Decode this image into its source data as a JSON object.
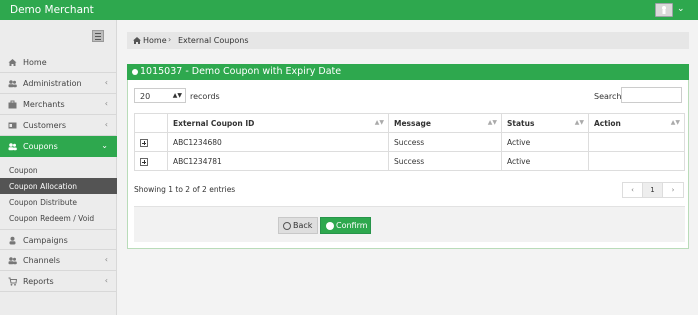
{
  "app": {
    "title": "Demo Merchant"
  },
  "sidebar": {
    "items": [
      {
        "label": "Home",
        "icon": "home-icon",
        "chevron": ""
      },
      {
        "label": "Administration",
        "icon": "users-icon",
        "chevron": "‹"
      },
      {
        "label": "Merchants",
        "icon": "briefcase-icon",
        "chevron": "‹"
      },
      {
        "label": "Customers",
        "icon": "id-card-icon",
        "chevron": "‹"
      },
      {
        "label": "Coupons",
        "icon": "users-icon",
        "chevron": "⌄"
      },
      {
        "label": "Campaigns",
        "icon": "user-icon",
        "chevron": ""
      },
      {
        "label": "Channels",
        "icon": "users-icon",
        "chevron": "‹"
      },
      {
        "label": "Reports",
        "icon": "cart-icon",
        "chevron": "‹"
      }
    ],
    "sub_items": [
      {
        "label": "Coupon"
      },
      {
        "label": "Coupon Allocation"
      },
      {
        "label": "Coupon Distribute"
      },
      {
        "label": "Coupon Redeem / Void"
      }
    ]
  },
  "breadcrumb": {
    "home": "Home",
    "separator": "›",
    "current": "External Coupons"
  },
  "panel": {
    "title": "1015037 - Demo Coupon with Expiry Date",
    "length_value": "20",
    "records_label": "records",
    "search_label": "Search:",
    "search_value": "",
    "columns": [
      "",
      "External Coupon ID",
      "Message",
      "Status",
      "Action"
    ],
    "rows": [
      {
        "id": "ABC1234680",
        "message": "Success",
        "status": "Active",
        "action": ""
      },
      {
        "id": "ABC1234781",
        "message": "Success",
        "status": "Active",
        "action": ""
      }
    ],
    "info": "Showing 1 to 2 of 2 entries",
    "pager": {
      "prev": "‹",
      "page": "1",
      "next": "›"
    },
    "back_label": "Back",
    "confirm_label": "Confirm"
  },
  "colors": {
    "brand": "#2ea84e",
    "sidebar_selected": "#545454"
  }
}
